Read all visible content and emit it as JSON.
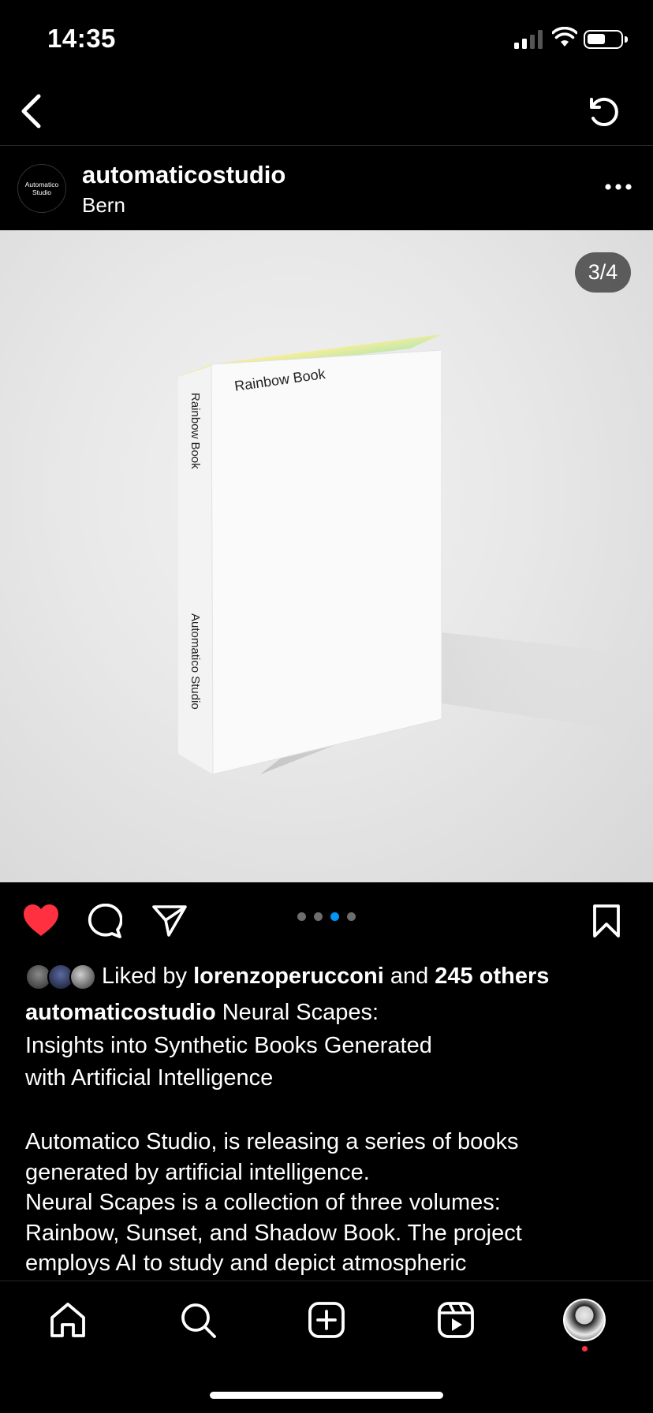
{
  "status_bar": {
    "time": "14:35"
  },
  "post": {
    "username": "automaticostudio",
    "location": "Bern",
    "avatar_text": "Automatico Studio",
    "image_counter": "3/4",
    "image": {
      "book_cover_title": "Rainbow Book",
      "spine_title": "Rainbow Book",
      "spine_author": "Automatico Studio"
    },
    "carousel": {
      "count": 4,
      "active_index": 2
    },
    "likes": {
      "prefix": "Liked by",
      "user": "lorenzoperucconi",
      "conjunction": "and",
      "others": "245 others"
    },
    "caption": {
      "username": "automaticostudio",
      "line1": "Neural Scapes:",
      "line2": "Insights into Synthetic Books Generated",
      "line3": "with Artificial Intelligence"
    },
    "body_lines": [
      "Automatico Studio, is releasing a series of books",
      "generated by artificial intelligence.",
      "Neural Scapes is a collection of three volumes:",
      "Rainbow, Sunset, and Shadow Book. The project",
      "employs AI to study and depict atmospheric"
    ]
  },
  "icons": {
    "back": "chevron-left-icon",
    "refresh": "refresh-icon",
    "more": "more-horizontal-icon",
    "like": "heart-filled-icon",
    "comment": "comment-icon",
    "share": "paper-plane-icon",
    "save": "bookmark-icon",
    "home": "home-icon",
    "search": "search-icon",
    "create": "plus-square-icon",
    "reels": "reels-icon",
    "profile": "profile-avatar"
  },
  "colors": {
    "background": "#000000",
    "like_red": "#ff3040",
    "active_dot": "#0095f6"
  }
}
